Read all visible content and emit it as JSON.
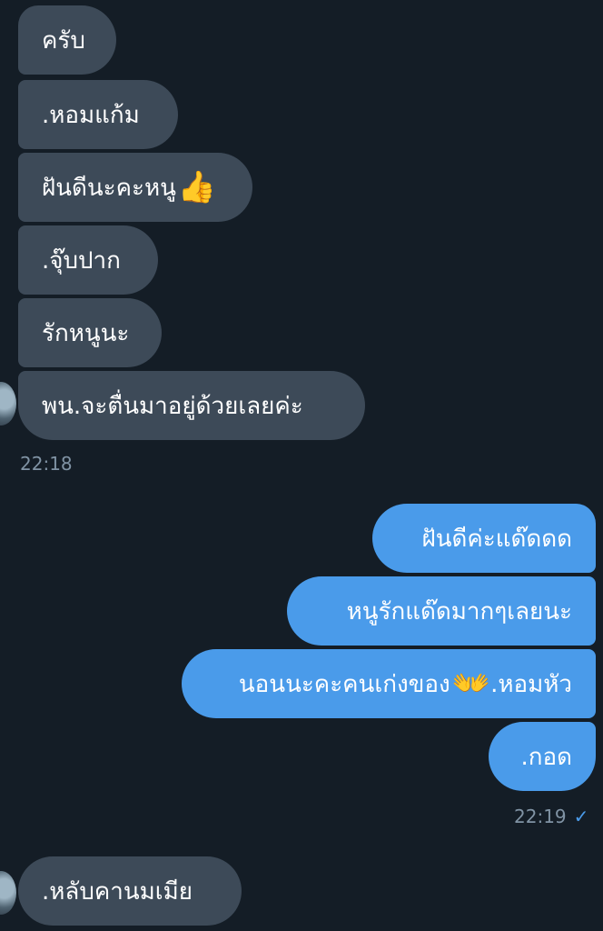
{
  "incoming_group_1": {
    "messages": [
      {
        "text": "ครับ"
      },
      {
        "text": ".หอมแก้ม"
      },
      {
        "text": "ฝันดีนะคะหนู",
        "emoji": "👍"
      },
      {
        "text": ".จุ๊บปาก"
      },
      {
        "text": "รักหนูนะ"
      },
      {
        "text": "พน.จะตื่นมาอยู่ด้วยเลยค่ะ"
      }
    ],
    "time": "22:18"
  },
  "outgoing_group": {
    "messages": [
      {
        "text": "ฝันดีค่ะแด๊ดดด"
      },
      {
        "text": "หนูรักแด๊ดมากๆเลยนะ"
      },
      {
        "text_before": "นอนนะคะคนเก่งของ",
        "emoji": "👐",
        "text_after": ".หอมหัว"
      },
      {
        "text": ".กอด"
      }
    ],
    "time": "22:19",
    "status_icon": "check-icon",
    "status_glyph": "✓"
  },
  "incoming_group_2": {
    "messages": [
      {
        "text": ".หลับคานมเมีย"
      }
    ]
  },
  "colors": {
    "background": "#141d26",
    "incoming_bubble": "#3d4a58",
    "outgoing_bubble": "#4a9bea",
    "timestamp": "#8093a4"
  }
}
